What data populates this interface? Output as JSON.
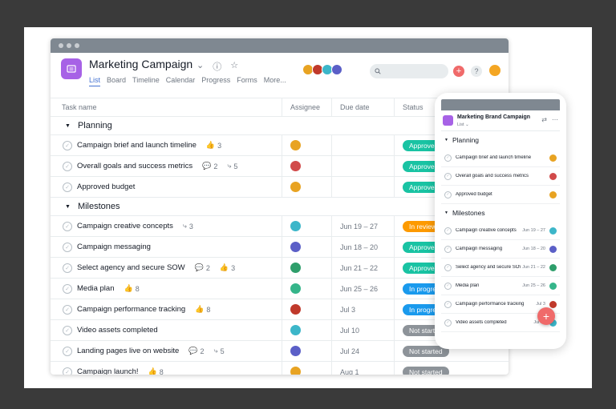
{
  "project": {
    "title": "Marketing Campaign",
    "tabs": [
      "List",
      "Board",
      "Timeline",
      "Calendar",
      "Progress",
      "Forms",
      "More..."
    ]
  },
  "colors": {
    "accent": "#4573d2",
    "project_icon": "#a762e6",
    "approved": "#19c3a3",
    "in_review": "#fd9a00",
    "in_progress": "#1a9aed",
    "not_started": "#8d9399",
    "add_button": "#f06a6a"
  },
  "columns": {
    "task": "Task name",
    "assignee": "Assignee",
    "due": "Due date",
    "status": "Status"
  },
  "sections": [
    {
      "name": "Planning",
      "tasks": [
        {
          "name": "Campaign brief and launch timeline",
          "likes": "3",
          "comments": "",
          "subtasks": "",
          "due": "",
          "status": "Approved",
          "status_color": "#19c3a3",
          "avatar": "#e8a322"
        },
        {
          "name": "Overall goals and success metrics",
          "likes": "",
          "comments": "2",
          "subtasks": "5",
          "due": "",
          "status": "Approved",
          "status_color": "#19c3a3",
          "avatar": "#d14a4a"
        },
        {
          "name": "Approved budget",
          "likes": "",
          "comments": "",
          "subtasks": "",
          "due": "",
          "status": "Approved",
          "status_color": "#19c3a3",
          "avatar": "#e8a322"
        }
      ]
    },
    {
      "name": "Milestones",
      "tasks": [
        {
          "name": "Campaign creative concepts",
          "likes": "",
          "comments": "",
          "subtasks": "3",
          "due": "Jun 19 – 27",
          "status": "In review",
          "status_color": "#fd9a00",
          "avatar": "#3cb6c9"
        },
        {
          "name": "Campaign messaging",
          "likes": "",
          "comments": "",
          "subtasks": "",
          "due": "Jun 18 – 20",
          "status": "Approved",
          "status_color": "#19c3a3",
          "avatar": "#5b5fc7"
        },
        {
          "name": "Select agency and secure SOW",
          "likes": "3",
          "comments": "2",
          "subtasks": "",
          "due": "Jun 21 – 22",
          "status": "Approved",
          "status_color": "#19c3a3",
          "avatar": "#2e9e6b"
        },
        {
          "name": "Media plan",
          "likes": "8",
          "comments": "",
          "subtasks": "",
          "due": "Jun 25 – 26",
          "status": "In progress",
          "status_color": "#1a9aed",
          "avatar": "#35b58a"
        },
        {
          "name": "Campaign performance tracking",
          "likes": "8",
          "comments": "",
          "subtasks": "",
          "due": "Jul 3",
          "status": "In progress",
          "status_color": "#1a9aed",
          "avatar": "#c0392b"
        },
        {
          "name": "Video assets completed",
          "likes": "",
          "comments": "",
          "subtasks": "",
          "due": "Jul 10",
          "status": "Not started",
          "status_color": "#8d9399",
          "avatar": "#3cb6c9"
        },
        {
          "name": "Landing pages live on website",
          "likes": "",
          "comments": "2",
          "subtasks": "5",
          "due": "Jul 24",
          "status": "Not started",
          "status_color": "#8d9399",
          "avatar": "#5b5fc7"
        },
        {
          "name": "Campaign launch!",
          "likes": "8",
          "comments": "",
          "subtasks": "",
          "due": "Aug 1",
          "status": "Not started",
          "status_color": "#8d9399",
          "avatar": "#e8a322"
        }
      ]
    }
  ],
  "mobile": {
    "title": "Marketing Brand Campaign",
    "view": "List ⌄",
    "sections": [
      {
        "name": "Planning",
        "tasks": [
          {
            "name": "Campaign brief and launch timeline",
            "due": "",
            "avatar": "#e8a322"
          },
          {
            "name": "Overall goals and success metrics",
            "due": "",
            "avatar": "#d14a4a"
          },
          {
            "name": "Approved budget",
            "due": "",
            "avatar": "#e8a322"
          }
        ]
      },
      {
        "name": "Milestones",
        "tasks": [
          {
            "name": "Campaign creative concepts",
            "due": "Jun 19 – 27",
            "avatar": "#3cb6c9"
          },
          {
            "name": "Campaign messaging",
            "due": "Jun 18 – 20",
            "avatar": "#5b5fc7"
          },
          {
            "name": "Select agency and secure SOW",
            "due": "Jun 21 – 22",
            "avatar": "#2e9e6b"
          },
          {
            "name": "Media plan",
            "due": "Jun 25 – 26",
            "avatar": "#35b58a"
          },
          {
            "name": "Campaign performance tracking",
            "due": "Jul 3",
            "avatar": "#c0392b"
          },
          {
            "name": "Video assets completed",
            "due": "Jul 10",
            "avatar": "#3cb6c9"
          }
        ]
      }
    ]
  }
}
